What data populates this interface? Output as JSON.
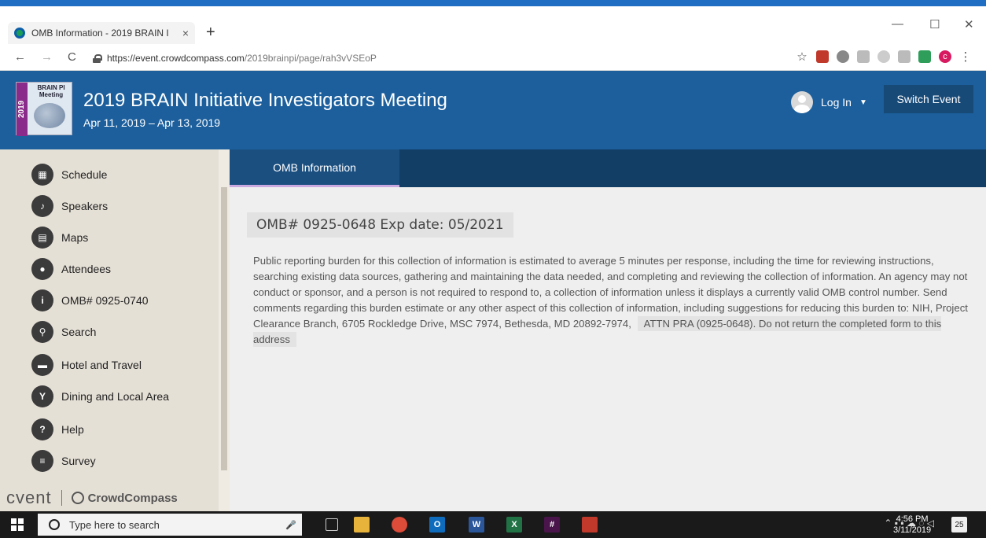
{
  "browser": {
    "tab_title": "OMB Information - 2019 BRAIN I",
    "tab_close": "×",
    "new_tab": "+",
    "url_host": "https://event.crowdcompass.com",
    "url_path": "/2019brainpi/page/rah3vVSEoP",
    "back": "←",
    "forward": "→",
    "reload": "C",
    "minimize": "—",
    "maximize": "☐",
    "close": "✕",
    "star": "☆",
    "profile_letter": "c",
    "menu": "⋮"
  },
  "header": {
    "logo_year": "2019",
    "logo_text": "BRAIN PI Meeting",
    "event_title": "2019 BRAIN Initiative Investigators Meeting",
    "event_dates": "Apr 11, 2019 – Apr 13, 2019",
    "login_label": "Log In",
    "switch_event_label": "Switch Event"
  },
  "sidebar": {
    "items": [
      {
        "label": "Schedule",
        "icon": "schedule-icon",
        "glyph": "▦"
      },
      {
        "label": "Speakers",
        "icon": "microphone-icon",
        "glyph": "♪"
      },
      {
        "label": "Maps",
        "icon": "map-icon",
        "glyph": "▤"
      },
      {
        "label": "Attendees",
        "icon": "attendees-icon",
        "glyph": "●"
      },
      {
        "label": "OMB# 0925-0740",
        "icon": "info-icon",
        "glyph": "i"
      },
      {
        "label": "Search",
        "icon": "search-icon",
        "glyph": "⚲"
      },
      {
        "label": "Hotel and Travel",
        "icon": "car-icon",
        "glyph": "▬"
      },
      {
        "label": "Dining and Local Area",
        "icon": "dining-icon",
        "glyph": "Y"
      },
      {
        "label": "Help",
        "icon": "help-icon",
        "glyph": "?"
      },
      {
        "label": "Survey",
        "icon": "survey-icon",
        "glyph": "≡"
      }
    ],
    "footer_cvent": "cvent",
    "footer_crowdcompass": "CrowdCompass"
  },
  "main": {
    "active_tab": "OMB Information",
    "heading": "OMB# 0925-0648 Exp date: 05/2021",
    "body": "Public reporting burden for this collection of information is estimated to average 5 minutes per response, including the time for reviewing instructions, searching existing data sources, gathering and maintaining the data needed, and completing and reviewing the collection of information. An agency may not conduct or sponsor, and a person is not required to respond to, a collection of information unless it displays a currently valid OMB control number. Send comments regarding this burden estimate or any other aspect of this collection of information, including suggestions for reducing this burden to: NIH, Project Clearance Branch, 6705 Rockledge Drive, MSC 7974, Bethesda, MD 20892-7974,",
    "body_highlight": "ATTN PRA (0925-0648). Do not return the completed form to this address"
  },
  "taskbar": {
    "search_placeholder": "Type here to search",
    "time": "4:56 PM",
    "date": "3/11/2019",
    "notification_count": "25"
  },
  "colors": {
    "header_bg": "#1c5f9c",
    "subnav_bg": "#123e66",
    "sidebar_bg": "#e5e0d6",
    "content_bg": "#efefef"
  }
}
